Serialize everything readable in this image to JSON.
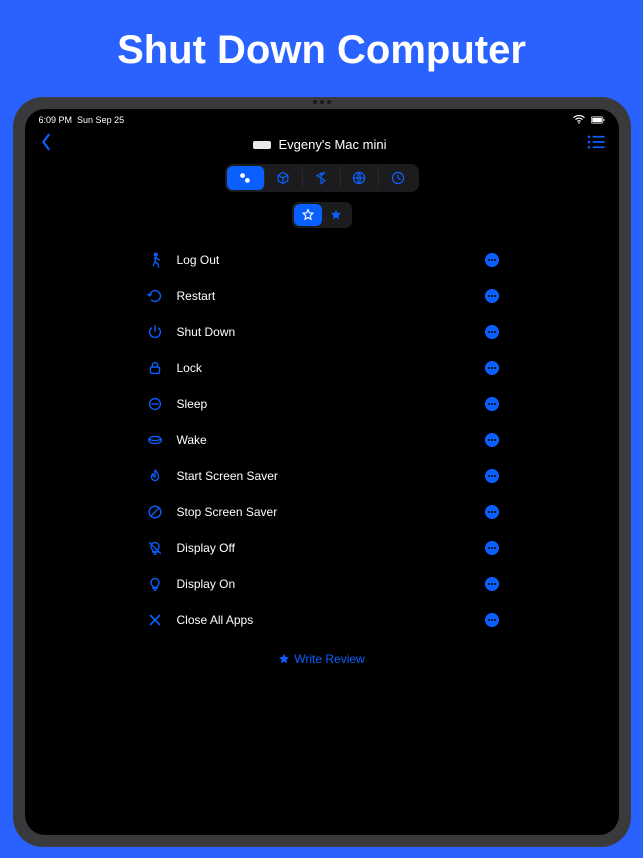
{
  "promo": {
    "title": "Shut Down Computer"
  },
  "status": {
    "time": "6:09 PM",
    "date": "Sun Sep 25"
  },
  "header": {
    "device_name": "Evgeny's Mac mini"
  },
  "accent": "#0a60ff",
  "commands": [
    {
      "icon": "walk",
      "label": "Log Out"
    },
    {
      "icon": "restart",
      "label": "Restart"
    },
    {
      "icon": "power",
      "label": "Shut Down"
    },
    {
      "icon": "lock",
      "label": "Lock"
    },
    {
      "icon": "sleep",
      "label": "Sleep"
    },
    {
      "icon": "wake",
      "label": "Wake"
    },
    {
      "icon": "fire",
      "label": "Start Screen Saver"
    },
    {
      "icon": "stop",
      "label": "Stop Screen Saver"
    },
    {
      "icon": "bulb-off",
      "label": "Display Off"
    },
    {
      "icon": "bulb-on",
      "label": "Display On"
    },
    {
      "icon": "close",
      "label": "Close All Apps"
    }
  ],
  "review": {
    "label": "Write Review"
  }
}
